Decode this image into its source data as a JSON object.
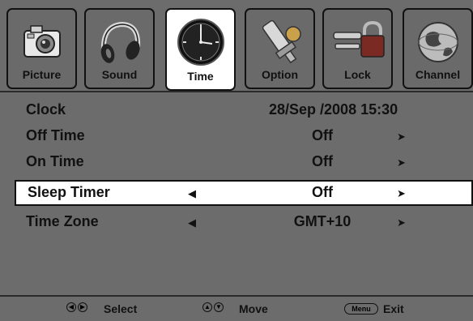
{
  "colors": {
    "background": "#6c6c6c",
    "active_tab": "#ffffff",
    "text": "#111111"
  },
  "tabs": [
    {
      "label": "Picture",
      "icon": "camera-icon",
      "active": false
    },
    {
      "label": "Sound",
      "icon": "headphones-icon",
      "active": false
    },
    {
      "label": "Time",
      "icon": "clock-icon",
      "active": true
    },
    {
      "label": "Option",
      "icon": "gear-icon",
      "active": false
    },
    {
      "label": "Lock",
      "icon": "lock-icon",
      "active": false
    },
    {
      "label": "Channel",
      "icon": "globe-icon",
      "active": false
    }
  ],
  "menu": {
    "clock": {
      "label": "Clock",
      "value": "28/Sep  /2008 15:30"
    },
    "off_time": {
      "label": "Off Time",
      "value": "Off",
      "right_arrow": "➤"
    },
    "on_time": {
      "label": "On Time",
      "value": "Off",
      "right_arrow": "➤"
    },
    "sleep_timer": {
      "label": "Sleep Timer",
      "value": "Off",
      "left_arrow": "◀",
      "right_arrow": "➤",
      "selected": true
    },
    "time_zone": {
      "label": "Time Zone",
      "value": "GMT+10",
      "left_arrow": "◀",
      "right_arrow": "➤"
    }
  },
  "footer": {
    "select_icons": [
      "◀",
      "▶"
    ],
    "select_label": "Select",
    "move_icons": [
      "▲",
      "▼"
    ],
    "move_label": "Move",
    "menu_key": "Menu",
    "exit_label": "Exit"
  }
}
